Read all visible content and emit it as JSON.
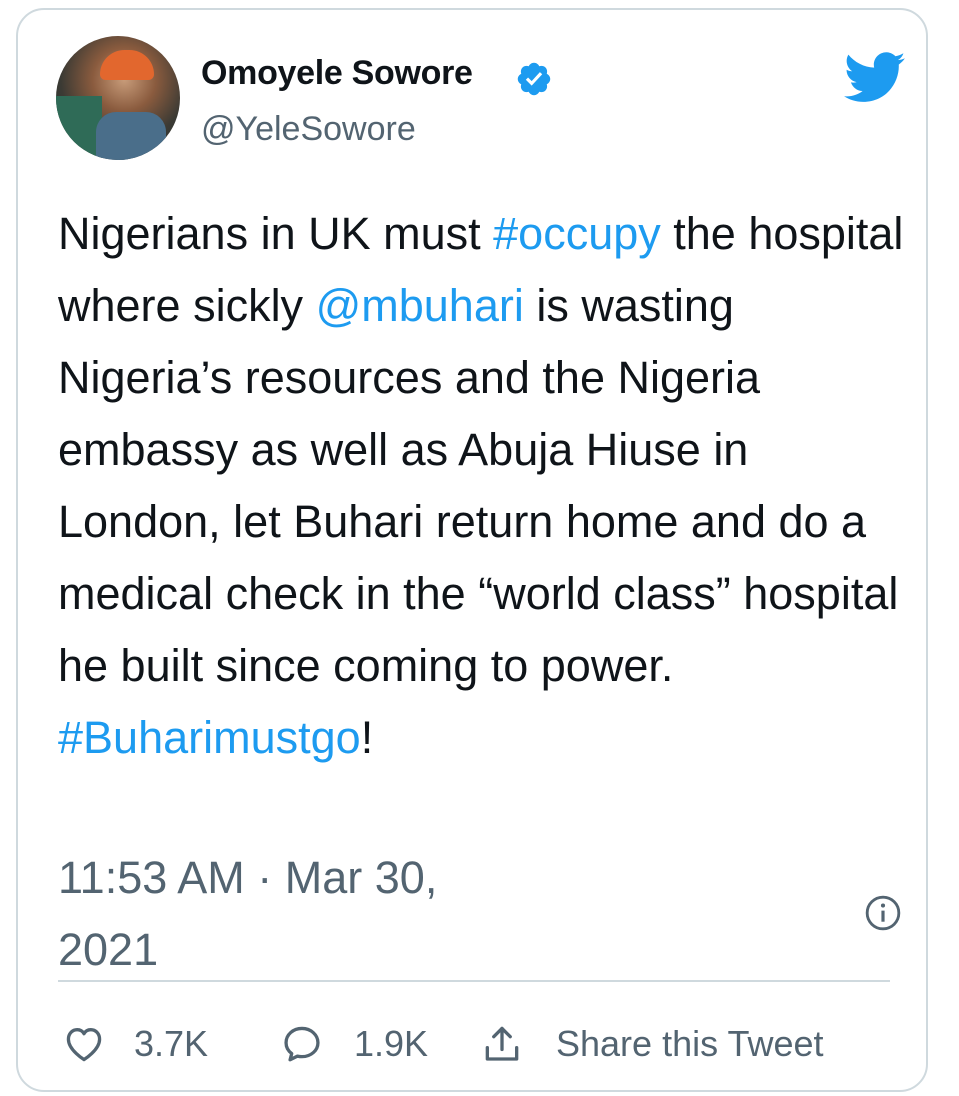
{
  "author": {
    "display_name": "Omoyele Sowore",
    "handle": "@YeleSowore",
    "verified": true
  },
  "tweet": {
    "segments": [
      {
        "text": "Nigerians in UK must ",
        "type": "text"
      },
      {
        "text": "#occupy",
        "type": "hashtag"
      },
      {
        "text": " the hospital where sickly ",
        "type": "text"
      },
      {
        "text": "@mbuhari",
        "type": "mention"
      },
      {
        "text": " is wasting Nigeria’s resources and the Nigeria embassy as well as Abuja Hiuse in London, let Buhari return home and do a medical check in the “world class” hospital he built since coming to power. ",
        "type": "text"
      },
      {
        "text": "#Buharimustgo",
        "type": "hashtag"
      },
      {
        "text": "!",
        "type": "text"
      }
    ],
    "timestamp": "11:53 AM · Mar 30, 2021"
  },
  "actions": {
    "like_count": "3.7K",
    "reply_count": "1.9K",
    "share_label": "Share this Tweet"
  },
  "icons": {
    "brand": "twitter-bird-icon",
    "verified": "verified-badge-icon",
    "info": "info-icon",
    "like": "heart-icon",
    "reply": "reply-bubble-icon",
    "share": "share-icon"
  },
  "colors": {
    "accent": "#1d9bf0",
    "text_primary": "#0f1419",
    "text_secondary": "#536471",
    "border": "#cfd9de"
  }
}
